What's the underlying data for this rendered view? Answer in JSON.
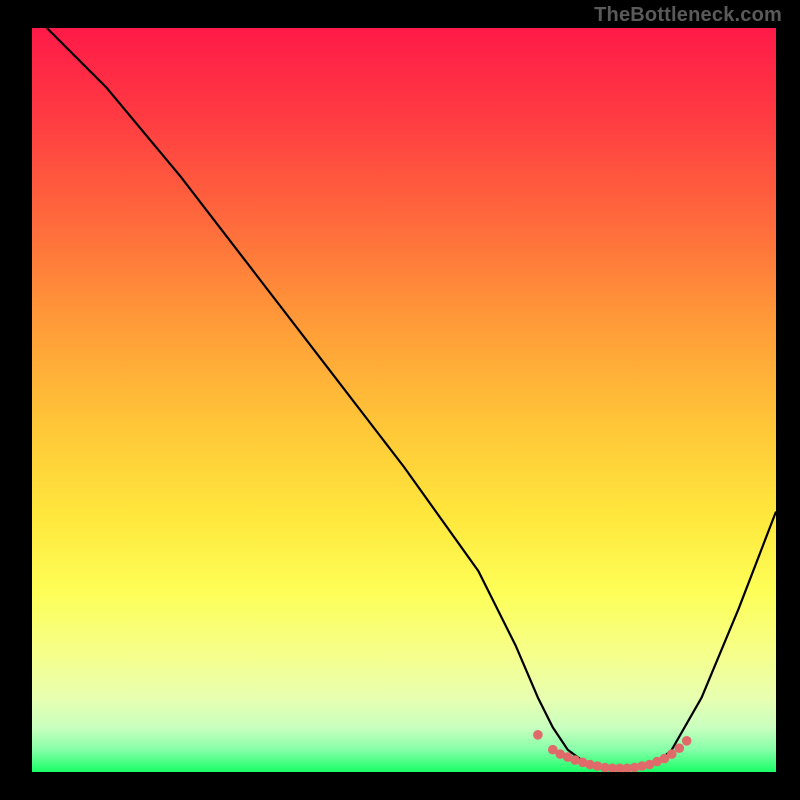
{
  "watermark": "TheBottleneck.com",
  "chart_data": {
    "type": "line",
    "title": "",
    "xlabel": "",
    "ylabel": "",
    "xlim": [
      0,
      100
    ],
    "ylim": [
      0,
      100
    ],
    "grid": false,
    "legend": false,
    "series": [
      {
        "name": "curve",
        "x": [
          2,
          5,
          10,
          20,
          30,
          40,
          50,
          60,
          65,
          68,
          70,
          72,
          74,
          76,
          78,
          80,
          82,
          84,
          86,
          90,
          95,
          100
        ],
        "y": [
          100,
          97,
          92,
          80,
          67,
          54,
          41,
          27,
          17,
          10,
          6,
          3,
          1.5,
          0.8,
          0.5,
          0.5,
          0.6,
          1.2,
          3,
          10,
          22,
          35
        ]
      }
    ],
    "highlight_dots": {
      "name": "flat-region",
      "x": [
        68,
        70,
        71,
        72,
        73,
        74,
        75,
        76,
        77,
        78,
        79,
        80,
        81,
        82,
        83,
        84,
        85,
        86,
        87,
        88
      ],
      "y": [
        5,
        3,
        2.4,
        2,
        1.6,
        1.3,
        1,
        0.8,
        0.6,
        0.5,
        0.5,
        0.5,
        0.6,
        0.8,
        1,
        1.4,
        1.8,
        2.4,
        3.2,
        4.2
      ]
    },
    "colors": {
      "line": "#000000",
      "dots": "#e06a6a",
      "gradient_top": "#ff1a48",
      "gradient_bottom": "#19ff66"
    }
  }
}
